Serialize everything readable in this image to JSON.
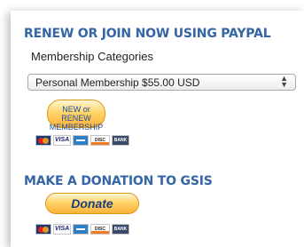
{
  "renew": {
    "heading": "RENEW OR JOIN NOW USING PAYPAL",
    "categories_label": "Membership Categories",
    "select_value": "Personal Membership $55.00 USD",
    "button_label": "NEW or RENEW MEMBERSHIP"
  },
  "donate": {
    "heading": "MAKE A DONATION TO GSIS",
    "button_label": "Donate"
  },
  "payment_icons": [
    "mastercard-icon",
    "visa-icon",
    "amex-icon",
    "discover-icon",
    "bank-icon"
  ],
  "colors": {
    "heading": "#3465a4",
    "paypal_button": "#ffc439",
    "paypal_text": "#1f4fa0"
  }
}
